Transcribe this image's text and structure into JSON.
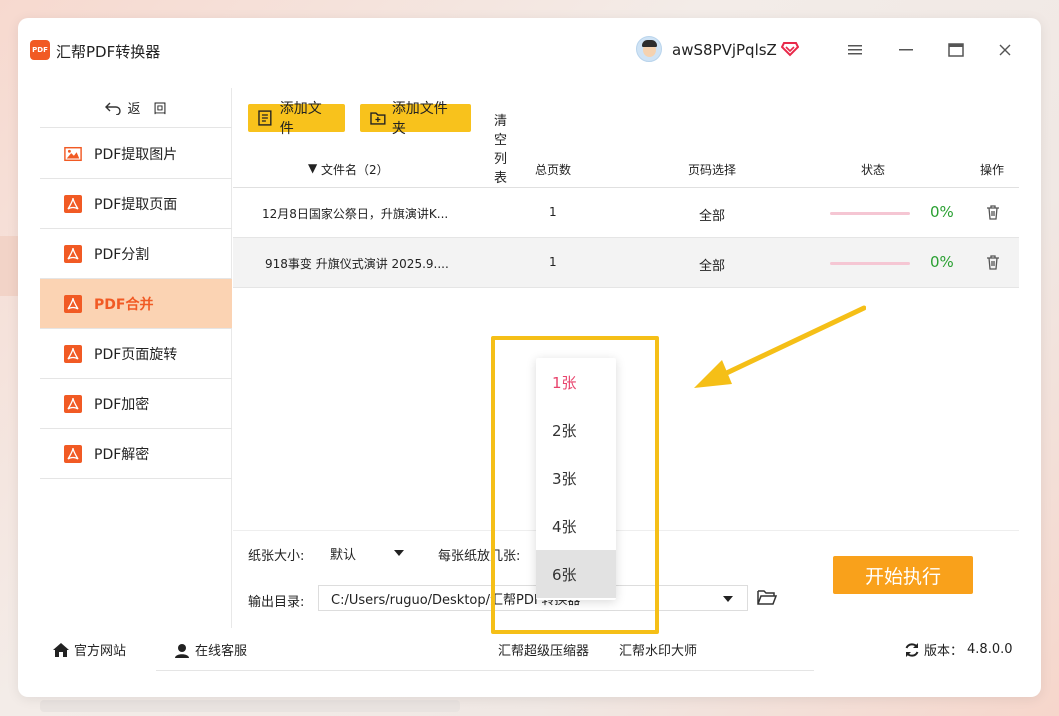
{
  "app": {
    "title": "汇帮PDF转换器",
    "logo_text": "PDF",
    "username": "awS8PVjPqlsZ"
  },
  "window_controls": {
    "menu": "menu-icon",
    "minimize": "minimize-icon",
    "maximize": "maximize-icon",
    "close": "close-icon"
  },
  "sidebar": {
    "back_label": "返　回",
    "items": [
      {
        "label": "PDF提取图片",
        "icon": "image-icon"
      },
      {
        "label": "PDF提取页面",
        "icon": "pdf-icon"
      },
      {
        "label": "PDF分割",
        "icon": "pdf-icon"
      },
      {
        "label": "PDF合并",
        "icon": "pdf-icon",
        "active": true
      },
      {
        "label": "PDF页面旋转",
        "icon": "pdf-icon"
      },
      {
        "label": "PDF加密",
        "icon": "pdf-icon"
      },
      {
        "label": "PDF解密",
        "icon": "pdf-icon"
      }
    ]
  },
  "toolbar": {
    "add_file": "添加文件",
    "add_folder": "添加文件夹",
    "clear_list": "清空列表"
  },
  "table": {
    "columns": {
      "filename": "文件名（2）",
      "pages": "总页数",
      "page_select": "页码选择",
      "status": "状态",
      "action": "操作"
    },
    "rows": [
      {
        "filename": "12月8日国家公祭日，升旗演讲K...",
        "pages": "1",
        "page_select": "全部",
        "progress": 0,
        "percent": "0%"
      },
      {
        "filename": "918事变 升旗仪式演讲 2025.9....",
        "pages": "1",
        "page_select": "全部",
        "progress": 0,
        "percent": "0%"
      }
    ]
  },
  "settings": {
    "paper_size_label": "纸张大小:",
    "paper_size_value": "默认",
    "per_sheet_label": "每张纸放几张:",
    "output_dir_label": "输出目录:",
    "output_dir_value": "C:/Users/ruguo/Desktop/汇帮PDF转换器",
    "start_button": "开始执行"
  },
  "dropdown": {
    "options": [
      "1张",
      "2张",
      "3张",
      "4张",
      "6张"
    ],
    "selected": "1张",
    "hovered": "6张"
  },
  "footer": {
    "website": "官方网站",
    "support": "在线客服",
    "link1": "汇帮超级压缩器",
    "link2": "汇帮水印大师",
    "version_label": "版本：",
    "version": "4.8.0.0"
  },
  "colors": {
    "accent": "#f15a24",
    "button_yellow": "#f8c21c",
    "start_orange": "#f9a11b",
    "active_bg": "#fbd3b3",
    "highlight": "#f5bf17",
    "progress_green": "#2aa032"
  }
}
